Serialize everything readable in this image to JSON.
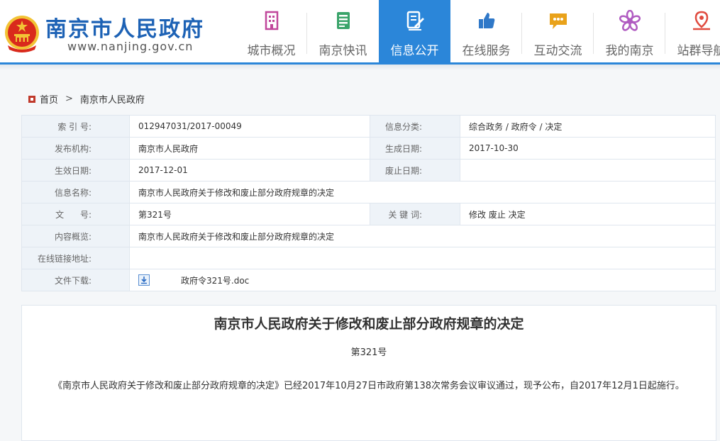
{
  "site": {
    "title": "南京市人民政府",
    "url": "www.nanjing.gov.cn"
  },
  "nav": [
    {
      "label": "城市概况",
      "icon": "building-icon",
      "color": "#c0479b"
    },
    {
      "label": "南京快讯",
      "icon": "news-icon",
      "color": "#3aa46a"
    },
    {
      "label": "信息公开",
      "icon": "document-edit-icon",
      "color": "#ffffff",
      "active": true
    },
    {
      "label": "在线服务",
      "icon": "thumbs-up-icon",
      "color": "#2f78c8"
    },
    {
      "label": "互动交流",
      "icon": "chat-bubble-icon",
      "color": "#e9a21a"
    },
    {
      "label": "我的南京",
      "icon": "flower-icon",
      "color": "#b05bc1"
    },
    {
      "label": "站群导航",
      "icon": "map-pin-icon",
      "color": "#e04b3f"
    }
  ],
  "colors": {
    "brand_blue": "#1d62b5",
    "nav_active": "#2b86d9",
    "label_bg": "#eef3f8",
    "emblem_red": "#d92a1c",
    "emblem_gold": "#f2c335"
  },
  "breadcrumb": {
    "home": "首页",
    "separator": ">",
    "current": "南京市人民政府"
  },
  "info": {
    "index_label": "索 引 号:",
    "index_value": "012947031/2017-00049",
    "category_label": "信息分类:",
    "category_value": "综合政务 / 政府令 / 决定",
    "publisher_label": "发布机构:",
    "publisher_value": "南京市人民政府",
    "created_label": "生成日期:",
    "created_value": "2017-10-30",
    "effective_label": "生效日期:",
    "effective_value": "2017-12-01",
    "abolished_label": "废止日期:",
    "abolished_value": "",
    "name_label": "信息名称:",
    "name_value": "南京市人民政府关于修改和废止部分政府规章的决定",
    "docno_label": "文      号:",
    "docno_value": "第321号",
    "keywords_label": "关 键 词:",
    "keywords_value": "修改 废止 决定",
    "summary_label": "内容概览:",
    "summary_value": "南京市人民政府关于修改和废止部分政府规章的决定",
    "link_label": "在线链接地址:",
    "link_value": "",
    "download_label": "文件下载:",
    "download_icon": "download-icon",
    "download_value": "政府令321号.doc"
  },
  "article": {
    "title": "南京市人民政府关于修改和废止部分政府规章的决定",
    "number": "第321号",
    "body": "《南京市人民政府关于修改和废止部分政府规章的决定》已经2017年10月27日市政府第138次常务会议审议通过，现予公布，自2017年12月1日起施行。"
  }
}
